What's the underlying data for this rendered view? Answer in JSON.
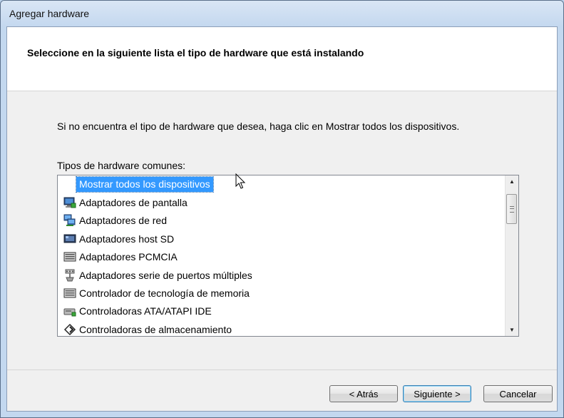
{
  "window": {
    "title": "Agregar hardware"
  },
  "header": {
    "text": "Seleccione en la siguiente lista el tipo de hardware que está instalando"
  },
  "instruction": "Si no encuentra el tipo de hardware que desea, haga clic en Mostrar todos los dispositivos.",
  "list": {
    "label": "Tipos de hardware comunes:",
    "items": [
      {
        "label": "Mostrar todos los dispositivos",
        "icon": "none",
        "selected": true
      },
      {
        "label": "Adaptadores de pantalla",
        "icon": "monitor-icon"
      },
      {
        "label": "Adaptadores de red",
        "icon": "network-icon"
      },
      {
        "label": "Adaptadores host SD",
        "icon": "sd-host-icon"
      },
      {
        "label": "Adaptadores PCMCIA",
        "icon": "pcmcia-icon"
      },
      {
        "label": "Adaptadores serie de puertos múltiples",
        "icon": "multiport-serial-icon"
      },
      {
        "label": "Controlador de tecnología de memoria",
        "icon": "memory-technology-icon"
      },
      {
        "label": "Controladoras ATA/ATAPI IDE",
        "icon": "ide-controller-icon"
      },
      {
        "label": "Controladoras de almacenamiento",
        "icon": "storage-controller-icon"
      }
    ]
  },
  "buttons": {
    "back": "< Atrás",
    "next": "Siguiente >",
    "cancel": "Cancelar"
  }
}
